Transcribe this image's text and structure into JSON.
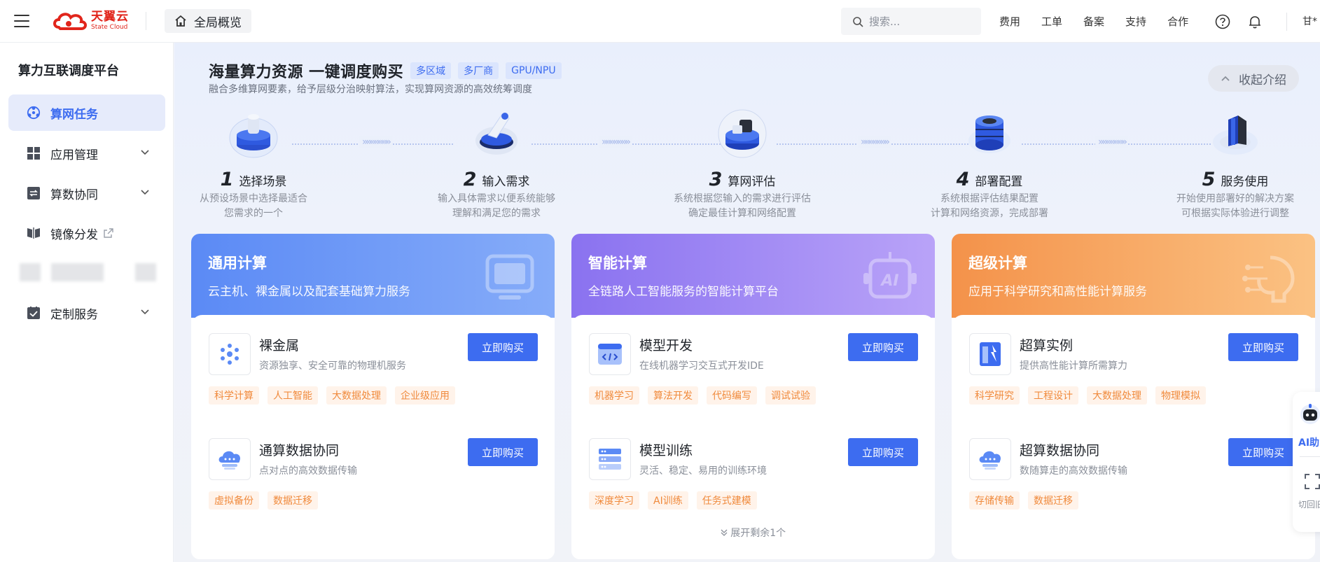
{
  "header": {
    "logo_cn": "天翼云",
    "logo_en": "State Cloud",
    "breadcrumb": "全局概览",
    "search_placeholder": "搜索...",
    "links": [
      "费用",
      "工单",
      "备案",
      "支持",
      "合作"
    ],
    "user": "甘*"
  },
  "sidebar": {
    "title": "算力互联调度平台",
    "items": [
      {
        "label": "算网任务",
        "icon": "network-task-icon",
        "active": true
      },
      {
        "label": "应用管理",
        "icon": "grid-icon",
        "expandable": true
      },
      {
        "label": "算数协同",
        "icon": "sync-icon",
        "expandable": true
      },
      {
        "label": "镜像分发",
        "icon": "mirror-icon",
        "external": true
      },
      {
        "label": "定制服务",
        "icon": "checkbox-icon",
        "expandable": true
      }
    ]
  },
  "intro": {
    "title": "海量算力资源 一键调度购买",
    "tags": [
      "多区域",
      "多厂商",
      "GPU/NPU"
    ],
    "subtitle": "融合多维算网要素，给予层级分治映射算法，实现算网资源的高效统筹调度",
    "collapse_label": "收起介绍",
    "steps": [
      {
        "num": "1",
        "name": "选择场景",
        "desc1": "从预设场景中选择最适合",
        "desc2": "您需求的一个"
      },
      {
        "num": "2",
        "name": "输入需求",
        "desc1": "输入具体需求以便系统能够",
        "desc2": "理解和满足您的需求"
      },
      {
        "num": "3",
        "name": "算网评估",
        "desc1": "系统根据您输入的需求进行评估",
        "desc2": "确定最佳计算和网络配置"
      },
      {
        "num": "4",
        "name": "部署配置",
        "desc1": "系统根据评估结果配置",
        "desc2": "计算和网络资源，完成部署"
      },
      {
        "num": "5",
        "name": "服务使用",
        "desc1": "开始使用部署好的解决方案",
        "desc2": "可根据实际体验进行调整"
      }
    ],
    "arrow_glyph": "»»»»»»»"
  },
  "cards": [
    {
      "title": "通用计算",
      "subtitle": "云主机、裸金属以及配套基础算力服务",
      "products": [
        {
          "name": "裸金属",
          "desc": "资源独享、安全可靠的物理机服务",
          "buy": "立即购买",
          "tags": [
            "科学计算",
            "人工智能",
            "大数据处理",
            "企业级应用"
          ]
        },
        {
          "name": "通算数据协同",
          "desc": "点对点的高效数据传输",
          "buy": "立即购买",
          "tags": [
            "虚拟备份",
            "数据迁移"
          ]
        }
      ]
    },
    {
      "title": "智能计算",
      "subtitle": "全链路人工智能服务的智能计算平台",
      "products": [
        {
          "name": "模型开发",
          "desc": "在线机器学习交互式开发IDE",
          "buy": "立即购买",
          "tags": [
            "机器学习",
            "算法开发",
            "代码编写",
            "调试试验"
          ]
        },
        {
          "name": "模型训练",
          "desc": "灵活、稳定、易用的训练环境",
          "buy": "立即购买",
          "tags": [
            "深度学习",
            "AI训练",
            "任务式建模"
          ]
        }
      ],
      "expand_label": "展开剩余1个"
    },
    {
      "title": "超级计算",
      "subtitle": "应用于科学研究和高性能计算服务",
      "products": [
        {
          "name": "超算实例",
          "desc": "提供高性能计算所需算力",
          "buy": "立即购买",
          "tags": [
            "科学研究",
            "工程设计",
            "大数据处理",
            "物理模拟"
          ]
        },
        {
          "name": "超算数据协同",
          "desc": "数随算走的高效数据传输",
          "buy": "立即购买",
          "tags": [
            "存储传输",
            "数据迁移"
          ]
        }
      ]
    }
  ],
  "float": {
    "ai_label": "AI助",
    "back_label": "切回旧"
  },
  "colors": {
    "accent": "#3d6cf0",
    "general_gradient": [
      "#5b8af5",
      "#7ea7f8"
    ],
    "ai_gradient": [
      "#8b74f0",
      "#b59cf7"
    ],
    "super_gradient": [
      "#f5954a",
      "#fbbf7f"
    ],
    "tag_bg": "#fff3ea",
    "tag_fg": "#f08a3c"
  }
}
